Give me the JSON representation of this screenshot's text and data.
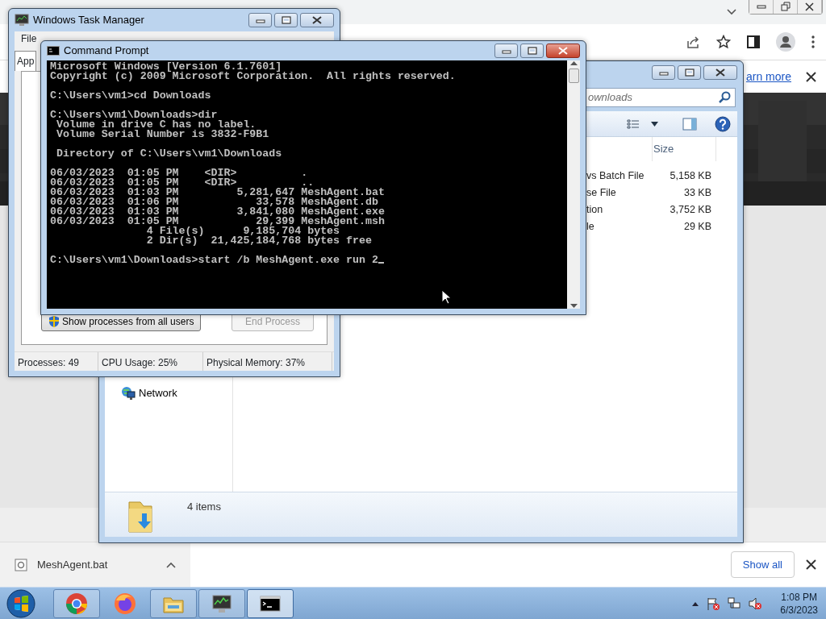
{
  "browser": {
    "infobar_link": "arn more"
  },
  "task_manager": {
    "title": "Windows Task Manager",
    "menu": [
      "File"
    ],
    "tabs": [
      {
        "label": "App",
        "selected": true
      }
    ],
    "buttons": [
      {
        "label": "Show processes from all users",
        "kind": "shield",
        "disabled": false
      },
      {
        "label": "End Process",
        "kind": "plain",
        "disabled": true
      }
    ],
    "status": [
      "Processes: 49",
      "CPU Usage: 25%",
      "Physical Memory: 37%"
    ]
  },
  "explorer": {
    "search_placeholder": "ownloads",
    "columns": [
      "Size"
    ],
    "rows": [
      {
        "type": "vs Batch File",
        "size": "5,158 KB"
      },
      {
        "type": "se File",
        "size": "33 KB"
      },
      {
        "type": "tion",
        "size": "3,752 KB"
      },
      {
        "type": "le",
        "size": "29 KB"
      }
    ],
    "nav_items": [
      "Network"
    ],
    "status": "4 items"
  },
  "command_prompt": {
    "title": "Command Prompt",
    "blocks": [
      [
        "Microsoft Windows [Version 6.1.7601]",
        "Copyright (c) 2009 Microsoft Corporation.  All rights reserved."
      ],
      [
        "C:\\Users\\vm1>cd Downloads"
      ],
      [
        "C:\\Users\\vm1\\Downloads>dir",
        " Volume in drive C has no label.",
        " Volume Serial Number is 3832-F9B1"
      ],
      [
        " Directory of C:\\Users\\vm1\\Downloads"
      ],
      [
        "06/03/2023  01:05 PM    <DIR>          .",
        "06/03/2023  01:05 PM    <DIR>          ..",
        "06/03/2023  01:03 PM         5,281,647 MeshAgent.bat",
        "06/03/2023  01:06 PM            33,578 MeshAgent.db",
        "06/03/2023  01:03 PM         3,841,080 MeshAgent.exe",
        "06/03/2023  01:05 PM            29,399 MeshAgent.msh",
        "               4 File(s)      9,185,704 bytes",
        "               2 Dir(s)  21,425,184,768 bytes free"
      ],
      [
        "C:\\Users\\vm1\\Downloads>start /b MeshAgent.exe run 2"
      ]
    ]
  },
  "downloads_bar": {
    "items": [
      {
        "name": "MeshAgent.bat"
      }
    ],
    "show_all": "Show all"
  },
  "taskbar": {
    "apps": [
      {
        "kind": "chrome",
        "running": true,
        "active": false
      },
      {
        "kind": "firefox",
        "running": false,
        "active": false
      },
      {
        "kind": "explorer",
        "running": true,
        "active": false
      },
      {
        "kind": "taskmgr",
        "running": true,
        "active": false
      },
      {
        "kind": "cmd",
        "running": true,
        "active": true
      }
    ],
    "clock": {
      "time": "1:08 PM",
      "date": "6/3/2023"
    }
  }
}
